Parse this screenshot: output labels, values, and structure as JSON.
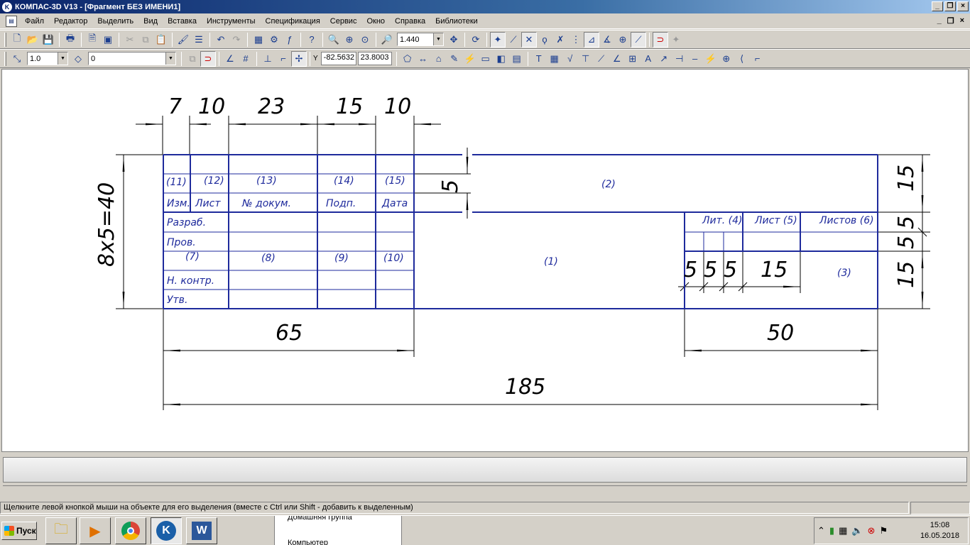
{
  "window": {
    "title": "КОМПАС-3D V13 - [Фрагмент БЕЗ ИМЕНИ1]",
    "app_icon": "kompas-icon"
  },
  "menu": [
    "Файл",
    "Редактор",
    "Выделить",
    "Вид",
    "Вставка",
    "Инструменты",
    "Спецификация",
    "Сервис",
    "Окно",
    "Справка",
    "Библиотеки"
  ],
  "toolbar1": {
    "zoom_value": "1.440"
  },
  "toolbar2": {
    "step_value": "1.0",
    "layer_value": "0",
    "coord_x_label": "Y",
    "coord_x": "-82.5632",
    "coord_y": "23.8003"
  },
  "drawing": {
    "dims_top": [
      "7",
      "10",
      "23",
      "15",
      "10"
    ],
    "dim_left": "8x5=40",
    "dim_65": "65",
    "dim_50": "50",
    "dim_185": "185",
    "dims_right": [
      "15",
      "5",
      "5",
      "15"
    ],
    "dim_5_vertical": "5",
    "dims_lit": [
      "5",
      "5",
      "5",
      "15"
    ],
    "col_numbers": [
      "(11)",
      "(12)",
      "(13)",
      "(14)",
      "(15)"
    ],
    "headers": [
      "Изм.",
      "Лист",
      "№ докум.",
      "Подп.",
      "Дата"
    ],
    "rows": [
      "Разраб.",
      "Пров.",
      "",
      "Н. контр.",
      "Утв."
    ],
    "col_numbers_2": [
      "(7)",
      "(8)",
      "(9)",
      "(10)"
    ],
    "field_1": "(1)",
    "field_2": "(2)",
    "field_3": "(3)",
    "lit_headers": [
      "Лит. (4)",
      "Лист (5)",
      "Листов (6)"
    ]
  },
  "status": {
    "hint": "Щелкните левой кнопкой мыши на объекте для его выделения (вместе с Ctrl или Shift - добавить к выделенным)"
  },
  "taskbar": {
    "start_label": "Пуск",
    "explorer_items": [
      "Домашняя группа",
      "Компьютер"
    ],
    "time": "15:08",
    "date": "16.05.2018"
  }
}
